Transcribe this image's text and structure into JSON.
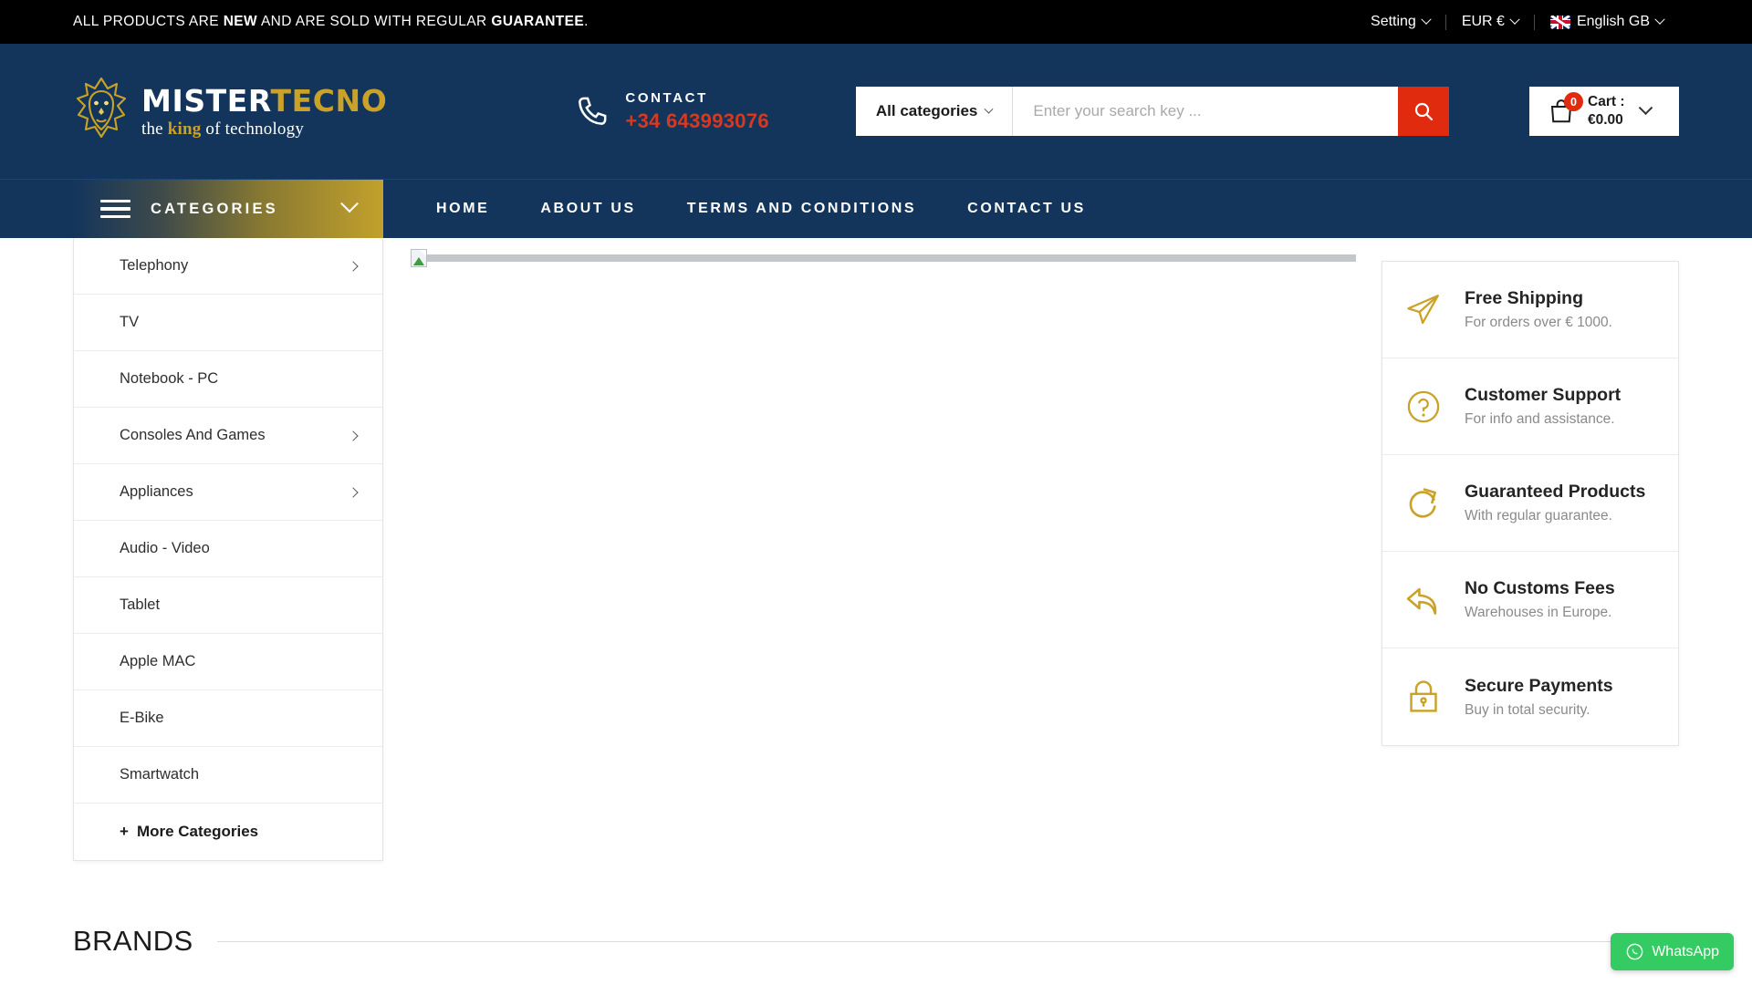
{
  "topbar": {
    "promo_prefix": "ALL PRODUCTS ARE ",
    "promo_new": "NEW",
    "promo_middle": " AND ARE SOLD WITH REGULAR ",
    "promo_guarantee": "GUARANTEE",
    "promo_suffix": ".",
    "setting_label": "Setting",
    "currency_label": "EUR €",
    "language_label": "English GB"
  },
  "header": {
    "logo_main_white": "MISTER",
    "logo_main_gold": "TECNO",
    "logo_sub_pre": "the ",
    "logo_sub_gold": "king",
    "logo_sub_post": " of technology",
    "contact_label": "CONTACT",
    "contact_number": "+34 643993076",
    "search_category": "All categories",
    "search_placeholder": "Enter your search key ...",
    "cart_count": "0",
    "cart_label": "Cart :",
    "cart_total": "€0.00"
  },
  "nav": {
    "categories_label": "CATEGORIES",
    "links": [
      {
        "label": "HOME"
      },
      {
        "label": "ABOUT US"
      },
      {
        "label": "TERMS AND CONDITIONS"
      },
      {
        "label": "CONTACT US"
      }
    ]
  },
  "sidebar": {
    "items": [
      {
        "label": "Telephony",
        "has_arrow": true
      },
      {
        "label": "TV",
        "has_arrow": false
      },
      {
        "label": "Notebook - PC",
        "has_arrow": false
      },
      {
        "label": "Consoles And Games",
        "has_arrow": true
      },
      {
        "label": "Appliances",
        "has_arrow": true
      },
      {
        "label": "Audio - Video",
        "has_arrow": false
      },
      {
        "label": "Tablet",
        "has_arrow": false
      },
      {
        "label": "Apple MAC",
        "has_arrow": false
      },
      {
        "label": "E-Bike",
        "has_arrow": false
      },
      {
        "label": "Smartwatch",
        "has_arrow": false
      }
    ],
    "more_label": "More Categories",
    "more_plus": "+"
  },
  "features": [
    {
      "icon": "paper-plane-icon",
      "title": "Free Shipping",
      "desc": "For orders over € 1000."
    },
    {
      "icon": "question-circle-icon",
      "title": "Customer Support",
      "desc": "For info and assistance."
    },
    {
      "icon": "refresh-icon",
      "title": "Guaranteed Products",
      "desc": "With regular guarantee."
    },
    {
      "icon": "reply-arrow-icon",
      "title": "No Customs Fees",
      "desc": "Warehouses in Europe."
    },
    {
      "icon": "lock-icon",
      "title": "Secure Payments",
      "desc": "Buy in total security."
    }
  ],
  "brands": {
    "title": "BRANDS"
  },
  "whatsapp": {
    "label": "WhatsApp"
  },
  "colors": {
    "navy": "#13355c",
    "gold": "#c2a12c",
    "red": "#e02b0f",
    "contact_red": "#d9381e",
    "whatsapp_green": "#34cb62",
    "black": "#000000"
  }
}
